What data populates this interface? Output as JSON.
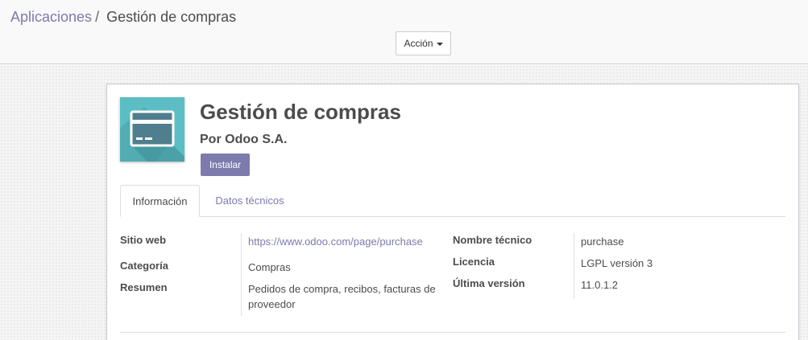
{
  "breadcrumb": {
    "parent": "Aplicaciones",
    "separator": "/",
    "current": "Gestión de compras"
  },
  "toolbar": {
    "action_label": "Acción"
  },
  "app": {
    "icon": "credit-card-icon",
    "title": "Gestión de compras",
    "author": "Por Odoo S.A.",
    "install_label": "Instalar"
  },
  "tabs": [
    {
      "label": "Información",
      "active": true
    },
    {
      "label": "Datos técnicos",
      "active": false
    }
  ],
  "info": {
    "website_label": "Sitio web",
    "website_value": "https://www.odoo.com/page/purchase",
    "category_label": "Categoría",
    "category_value": "Compras",
    "summary_label": "Resumen",
    "summary_value": "Pedidos de compra, recibos, facturas de proveedor",
    "technical_name_label": "Nombre técnico",
    "technical_name_value": "purchase",
    "license_label": "Licencia",
    "license_value": "LGPL versión 3",
    "latest_version_label": "Última versión",
    "latest_version_value": "11.0.1.2"
  },
  "colors": {
    "brand": "#7c7bad",
    "icon_bg": "#5bbec4",
    "icon_card": "#4f7f8f"
  }
}
